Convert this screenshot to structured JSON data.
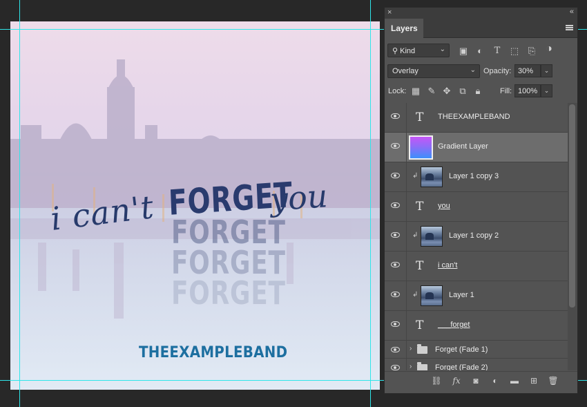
{
  "canvas": {
    "text_icant": "i can't",
    "text_forget": "FORGET",
    "text_you": "you",
    "fade_1": "FORGET",
    "fade_2": "FORGET",
    "fade_3": "FORGET",
    "band_name": "THEEXAMPLEBAND"
  },
  "panel": {
    "close_glyph": "×",
    "collapse_glyph": "«",
    "tab_label": "Layers",
    "filter": {
      "value": "Kind",
      "search_icon": "⚲"
    },
    "filter_icons": [
      "image-filter-icon",
      "adjustment-filter-icon",
      "type-filter-icon",
      "shape-filter-icon",
      "smart-object-filter-icon",
      "filter-toggle-icon"
    ],
    "blend_mode": "Overlay",
    "opacity_label": "Opacity:",
    "opacity_value": "30%",
    "lock_label": "Lock:",
    "fill_label": "Fill:",
    "fill_value": "100%",
    "layers": [
      {
        "name": "THEEXAMPLEBAND",
        "kind": "text",
        "underline": false
      },
      {
        "name": "Gradient Layer",
        "kind": "gradient",
        "selected": true
      },
      {
        "name": "Layer 1 copy 3",
        "kind": "image",
        "clipped": true
      },
      {
        "name": "you",
        "kind": "text",
        "underline": true
      },
      {
        "name": "Layer 1 copy 2",
        "kind": "image",
        "clipped": true
      },
      {
        "name": "i can't",
        "kind": "text",
        "underline": true
      },
      {
        "name": "Layer 1",
        "kind": "image",
        "clipped": true
      },
      {
        "name": "___forget",
        "kind": "text",
        "underline": true
      },
      {
        "name": "Forget (Fade 1)",
        "kind": "group"
      },
      {
        "name": "Forget (Fade 2)",
        "kind": "group"
      }
    ],
    "text_icon": "T",
    "clip_glyph": "↲",
    "folder_arrow": "›",
    "footer_icons": [
      "link-layers-icon",
      "fx-icon",
      "add-mask-icon",
      "adjustment-layer-icon",
      "new-group-icon",
      "new-layer-icon",
      "delete-layer-icon"
    ],
    "footer_fx": "fx"
  }
}
